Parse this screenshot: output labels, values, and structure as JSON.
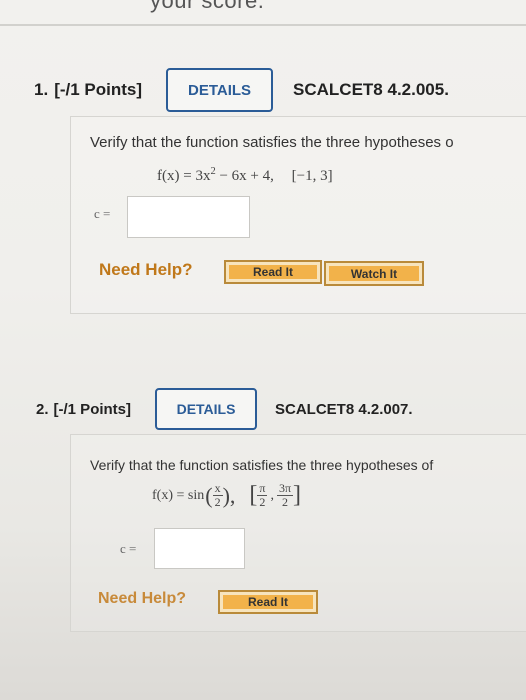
{
  "header": {
    "partial_text": "your score."
  },
  "questions": [
    {
      "number": "1.",
      "points": "[-/1 Points]",
      "details_label": "DETAILS",
      "code": "SCALCET8 4.2.005.",
      "prompt": "Verify that the function satisfies the three hypotheses o",
      "function_text": "f(x) = 3x",
      "exp": "2",
      "function_rest": " − 6x + 4,",
      "interval": "[−1, 3]",
      "answer_label": "c =",
      "need_help": "Need Help?",
      "read_label": "Read It",
      "watch_label": "Watch It"
    },
    {
      "number": "2.",
      "points": "[-/1 Points]",
      "details_label": "DETAILS",
      "code": "SCALCET8 4.2.007.",
      "prompt": "Verify that the function satisfies the three hypotheses of",
      "function_prefix": "f(x) = sin",
      "frac_num": "x",
      "frac_den": "2",
      "int_a_num": "π",
      "int_a_den": "2",
      "int_b_num": "3π",
      "int_b_den": "2",
      "answer_label": "c =",
      "need_help": "Need Help?",
      "read_label": "Read It"
    }
  ]
}
